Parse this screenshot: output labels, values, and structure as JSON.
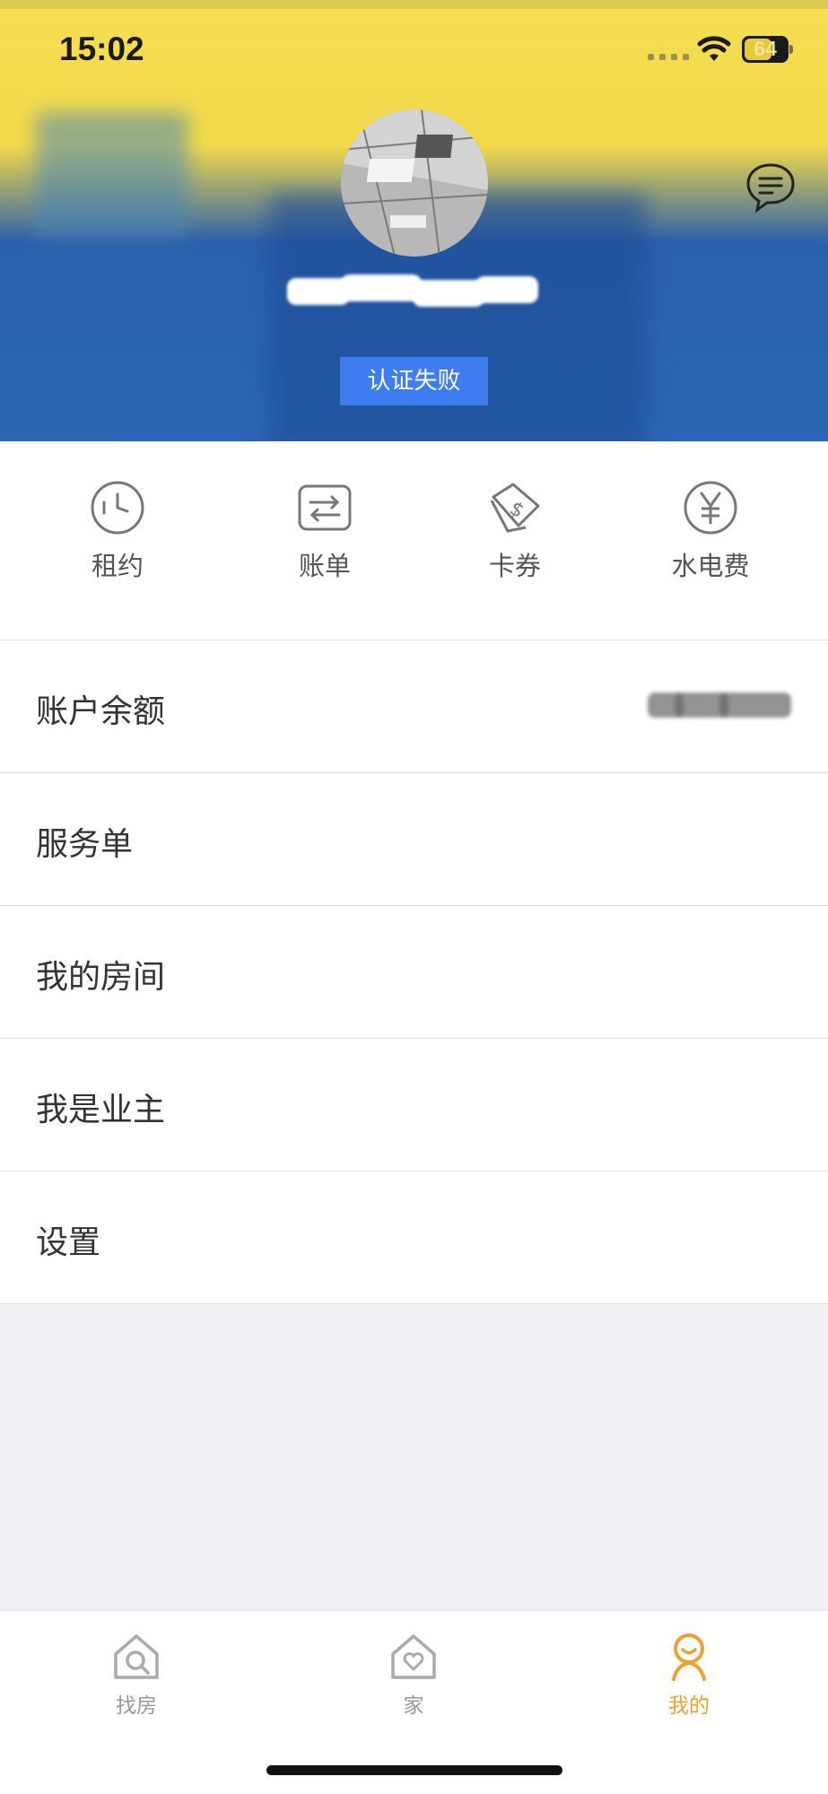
{
  "status_bar": {
    "time": "15:02",
    "battery": "64"
  },
  "header": {
    "auth_status": "认证失败",
    "avatar": "avatar",
    "message_icon": "message-icon"
  },
  "quick_menu": [
    {
      "label": "租约",
      "icon": "clock-icon"
    },
    {
      "label": "账单",
      "icon": "transfer-icon"
    },
    {
      "label": "卡券",
      "icon": "coupon-icon"
    },
    {
      "label": "水电费",
      "icon": "yen-icon"
    }
  ],
  "list": {
    "balance_label": "账户余额",
    "service_label": "服务单",
    "my_room_label": "我的房间",
    "owner_label": "我是业主",
    "settings_label": "设置"
  },
  "tabbar": {
    "tabs": [
      {
        "label": "找房",
        "icon": "search-house-icon",
        "active": false
      },
      {
        "label": "家",
        "icon": "heart-house-icon",
        "active": false
      },
      {
        "label": "我的",
        "icon": "person-icon",
        "active": true
      }
    ],
    "active_color": "#f0a030",
    "inactive_color": "#999999"
  },
  "colors": {
    "auth_badge": "#3e7df0",
    "header_yellow": "#f2d94a",
    "header_blue": "#2a66b3"
  }
}
